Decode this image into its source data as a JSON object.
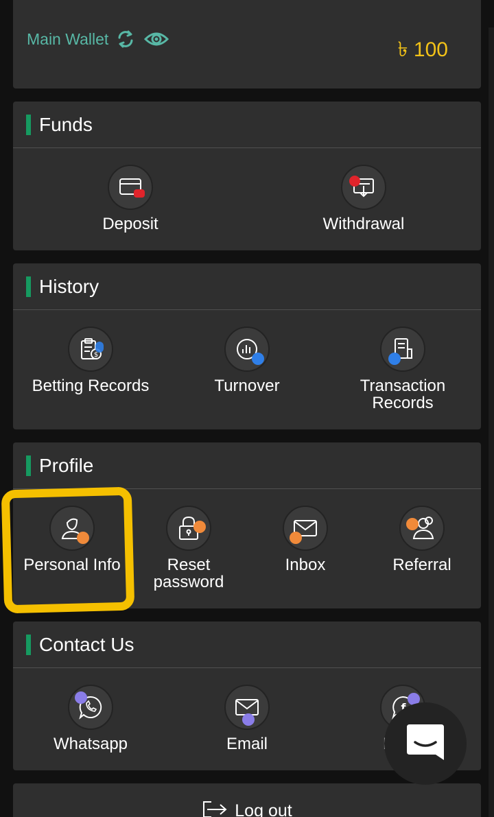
{
  "wallet": {
    "label": "Main Wallet",
    "amount": "৳ 100",
    "refresh_icon": "refresh-icon",
    "visibility_icon": "eye-icon"
  },
  "funds": {
    "title": "Funds",
    "items": [
      {
        "label": "Deposit",
        "icon": "deposit-icon"
      },
      {
        "label": "Withdrawal",
        "icon": "withdrawal-icon"
      }
    ]
  },
  "history": {
    "title": "History",
    "items": [
      {
        "label": "Betting Records",
        "icon": "betting-records-icon"
      },
      {
        "label": "Turnover",
        "icon": "turnover-icon"
      },
      {
        "label": "Transaction Records",
        "icon": "transaction-records-icon"
      }
    ]
  },
  "profile": {
    "title": "Profile",
    "items": [
      {
        "label": "Personal Info",
        "icon": "person-icon"
      },
      {
        "label": "Reset password",
        "icon": "lock-icon"
      },
      {
        "label": "Inbox",
        "icon": "envelope-icon"
      },
      {
        "label": "Referral",
        "icon": "users-icon"
      }
    ]
  },
  "contact": {
    "title": "Contact Us",
    "items": [
      {
        "label": "Whatsapp",
        "icon": "whatsapp-icon"
      },
      {
        "label": "Email",
        "icon": "email-icon"
      },
      {
        "label": "Fa",
        "icon": "facebook-icon"
      }
    ]
  },
  "logout": {
    "label": "Log out",
    "icon": "logout-icon"
  },
  "colors": {
    "accent": "#169a60",
    "wallet_label": "#58b8a6",
    "amount": "#f2c218",
    "highlight": "#f5c000",
    "dot_red": "#e0242b",
    "dot_blue": "#2f7fe8",
    "dot_orange": "#f08a3a",
    "dot_purple": "#8a7de8"
  }
}
